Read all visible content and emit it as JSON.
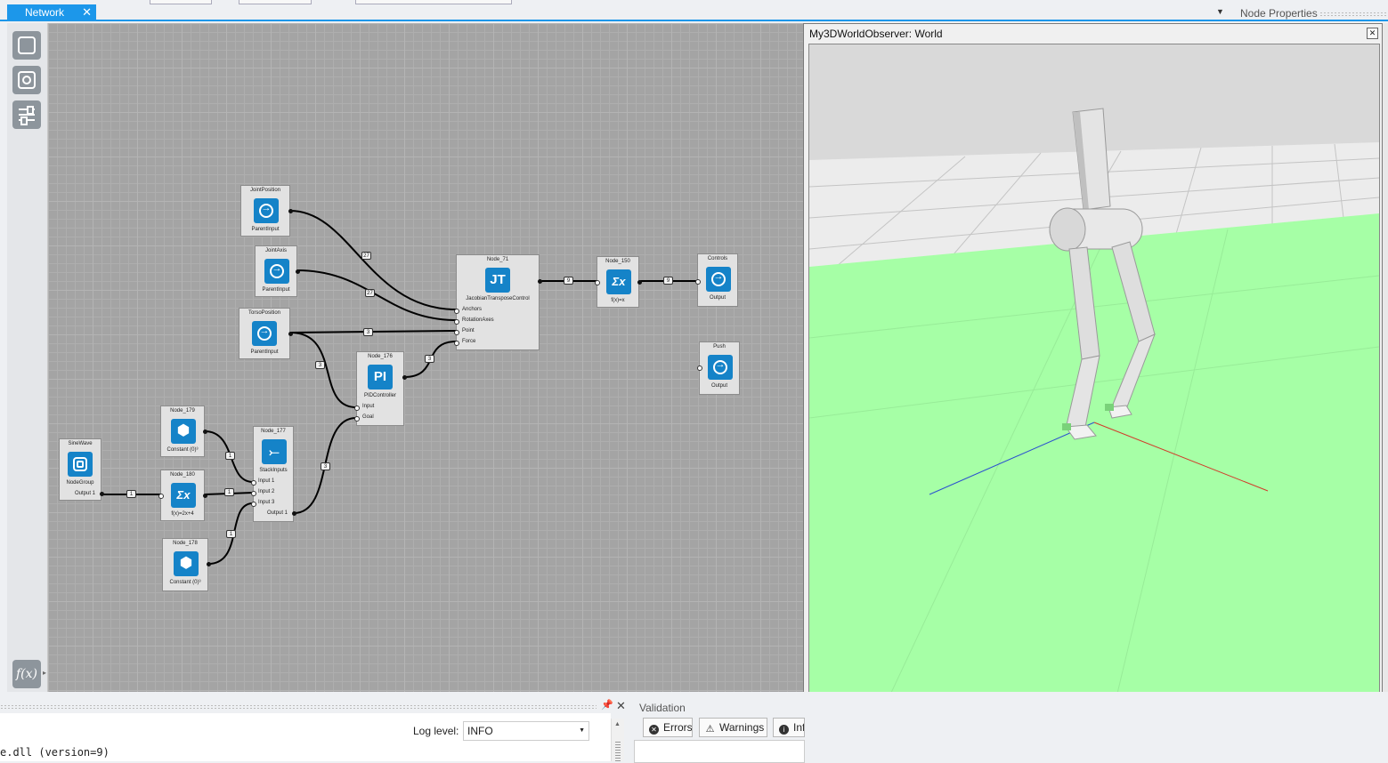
{
  "tabs": {
    "network": "Network",
    "close": "✕"
  },
  "node_properties": {
    "title": "Node Properties",
    "arrow": "▼"
  },
  "toolbar": {
    "fx_label": "f(x)",
    "fx_arrow": "▸"
  },
  "nodes": {
    "joint_position": {
      "title": "JointPosition",
      "sub": "ParentInput"
    },
    "joint_axis": {
      "title": "JointAxis",
      "sub": "ParentInput"
    },
    "torso_position": {
      "title": "TorsoPosition",
      "sub": "ParentInput"
    },
    "node_71": {
      "title": "Node_71",
      "icon": "JT",
      "sub": "JacobianTransposeControl",
      "ports": [
        "Anchors",
        "RotationAxes",
        "Point",
        "Force"
      ]
    },
    "node_150": {
      "title": "Node_150",
      "icon": "Σx",
      "sub": "f(x)=x"
    },
    "controls": {
      "title": "Controls",
      "sub": "Output"
    },
    "push": {
      "title": "Push",
      "sub": "Output"
    },
    "node_176": {
      "title": "Node_176",
      "icon": "PI",
      "sub": "PIDController",
      "ports": [
        "Input",
        "Goal"
      ]
    },
    "node_179": {
      "title": "Node_179",
      "sub": "Constant (0)³"
    },
    "sine_wave": {
      "title": "SineWave",
      "sub": "NodeGroup",
      "port": "Output 1"
    },
    "node_180": {
      "title": "Node_180",
      "icon": "Σx",
      "sub": "f(x)=2x+4"
    },
    "node_177": {
      "title": "Node_177",
      "sub": "StackInputs",
      "ports": [
        "Input 1",
        "Input 2",
        "Input 3"
      ],
      "out": "Output 1"
    },
    "node_178": {
      "title": "Node_178",
      "sub": "Constant (0)³"
    }
  },
  "badges": {
    "b27a": "27",
    "b27b": "27",
    "b3a": "3",
    "b3b": "3",
    "b3c": "3",
    "b9a": "9",
    "b9b": "9",
    "b1a": "1",
    "b1b": "1",
    "b1c": "1",
    "b1d": "1",
    "b3d": "3"
  },
  "viewer": {
    "title": "My3DWorldObserver: World",
    "close": "✕"
  },
  "output": {
    "pin": "📌",
    "close": "✕",
    "log_level_label": "Log level:",
    "log_level_value": "INFO",
    "text": "e.dll (version=9)"
  },
  "validation": {
    "title": "Validation",
    "errors": "Errors",
    "warnings": "Warnings",
    "info": "Inf"
  },
  "colors": {
    "accent": "#1c97ea",
    "node_icon": "#1583c8",
    "ground": "#a6ffa6",
    "floor": "#ececec",
    "sky": "#d9d9d9"
  }
}
